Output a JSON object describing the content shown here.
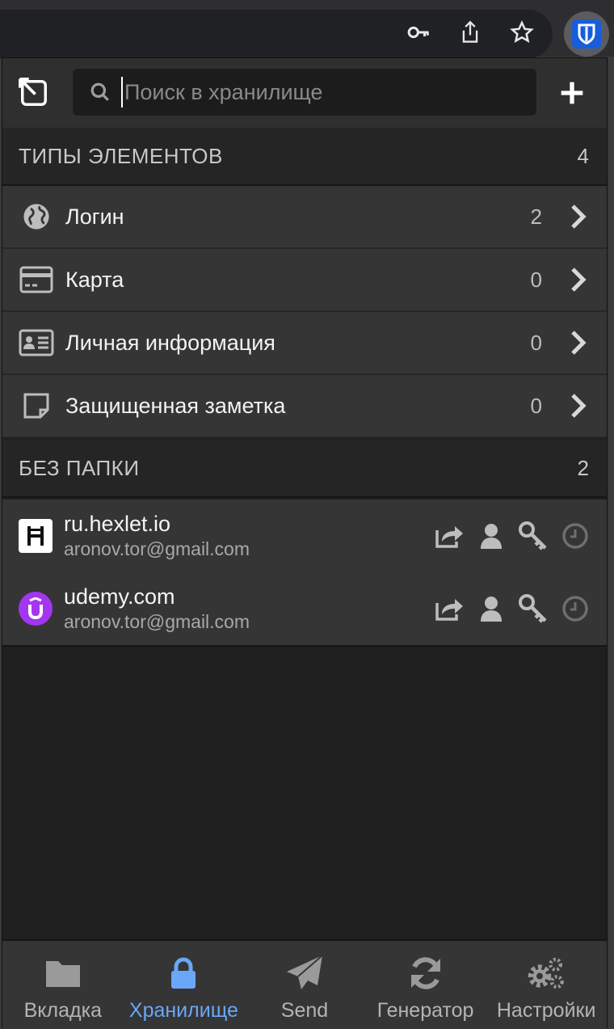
{
  "browser": {
    "icons": [
      "key-icon",
      "share-icon",
      "star-icon",
      "bitwarden-extension-icon"
    ]
  },
  "search": {
    "placeholder": "Поиск в хранилище"
  },
  "types_section": {
    "title": "ТИПЫ ЭЛЕМЕНТОВ",
    "count": "4",
    "items": [
      {
        "label": "Логин",
        "count": "2",
        "icon": "globe-icon"
      },
      {
        "label": "Карта",
        "count": "0",
        "icon": "credit-card-icon"
      },
      {
        "label": "Личная информация",
        "count": "0",
        "icon": "id-card-icon"
      },
      {
        "label": "Защищенная заметка",
        "count": "0",
        "icon": "note-icon"
      }
    ]
  },
  "no_folder_section": {
    "title": "БЕЗ ПАПКИ",
    "count": "2",
    "items": [
      {
        "name": "ru.hexlet.io",
        "username": "aronov.tor@gmail.com",
        "favicon": "hexlet-favicon"
      },
      {
        "name": "udemy.com",
        "username": "aronov.tor@gmail.com",
        "favicon": "udemy-favicon"
      }
    ]
  },
  "tabs": [
    {
      "label": "Вкладка",
      "icon": "folder-icon",
      "active": false
    },
    {
      "label": "Хранилище",
      "icon": "lock-icon",
      "active": true
    },
    {
      "label": "Send",
      "icon": "send-icon",
      "active": false
    },
    {
      "label": "Генератор",
      "icon": "refresh-icon",
      "active": false
    },
    {
      "label": "Настройки",
      "icon": "cogs-icon",
      "active": false
    }
  ],
  "colors": {
    "accent": "#6aa7f8",
    "brand": "#175ddc",
    "background": "#1f1f1f",
    "row": "#353535"
  }
}
